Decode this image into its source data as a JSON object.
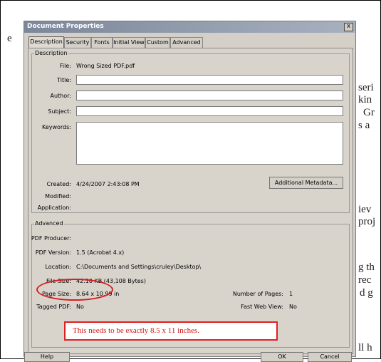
{
  "background_text": [
    {
      "text": "e",
      "pos": "l1"
    },
    {
      "text": "seri",
      "pos": "r1"
    },
    {
      "text": "kin",
      "pos": "r2"
    },
    {
      "text": "Gr",
      "pos": "r3"
    },
    {
      "text": "s a",
      "pos": "r4"
    },
    {
      "text": "iev",
      "pos": "r5"
    },
    {
      "text": "proj",
      "pos": "r6"
    },
    {
      "text": "g th",
      "pos": "r7"
    },
    {
      "text": "rec",
      "pos": "r8"
    },
    {
      "text": "d g",
      "pos": "r9"
    },
    {
      "text": "ll h",
      "pos": "r10"
    }
  ],
  "dialog": {
    "title": "Document Properties",
    "close_label": "x",
    "tabs": [
      "Description",
      "Security",
      "Fonts",
      "Initial View",
      "Custom",
      "Advanced"
    ],
    "description_group": {
      "label": "Description",
      "file_label": "File:",
      "file_value": "Wrong Sized PDF.pdf",
      "title_label": "Title:",
      "author_label": "Author:",
      "subject_label": "Subject:",
      "keywords_label": "Keywords:",
      "created_label": "Created:",
      "created_value": "4/24/2007 2:43:08 PM",
      "modified_label": "Modified:",
      "application_label": "Application:",
      "metadata_button": "Additional Metadata..."
    },
    "advanced_group": {
      "label": "Advanced",
      "producer_label": "PDF Producer:",
      "version_label": "PDF Version:",
      "version_value": "1.5 (Acrobat 4.x)",
      "location_label": "Location:",
      "location_value": "C:\\Documents and Settings\\cruley\\Desktop\\",
      "filesize_label": "File Size:",
      "filesize_value": "42.10 KB (43,108 Bytes)",
      "pagesize_label": "Page Size:",
      "pagesize_value": "8.64 x 10.99 in",
      "tagged_label": "Tagged PDF:",
      "tagged_value": "No",
      "pages_label": "Number of Pages:",
      "pages_value": "1",
      "fastweb_label": "Fast Web View:",
      "fastweb_value": "No"
    },
    "footer": {
      "help_label": "Help",
      "ok_label": "OK",
      "cancel_label": "Cancel"
    }
  },
  "annotation": {
    "note_text": "This needs to be exactly 8.5 x 11 inches.",
    "highlight_color": "#d42020"
  }
}
